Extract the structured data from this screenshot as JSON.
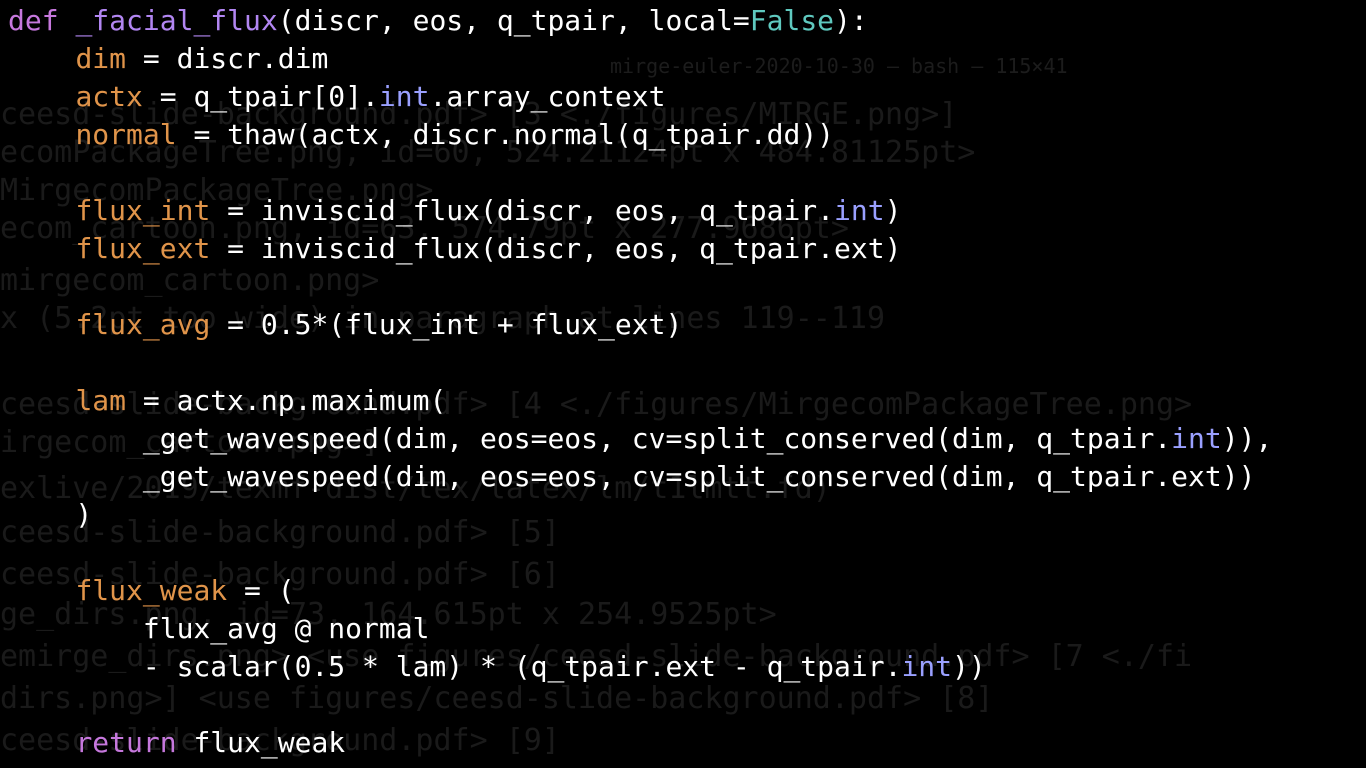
{
  "terminal": {
    "window_title": "mirge-euler-2020-10-30 — bash — 115×41",
    "background_output": [
      "ceesd-slide-background.pdf> [3 <./figures/MIRGE.png>]",
      "ecomPackageTree.png, id=60, 524.21124pt x 484.81125pt>",
      "MirgecomPackageTree.png>",
      "ecom_cartoon.png, id=63, 574.79pt x 277.9686pt>",
      "mirgecom_cartoon.png>",
      "x (5.2pt too wide) in paragraph at lines 119--119",
      "ceesd-slide-background.pdf> [4 <./figures/MirgecomPackageTree.png>",
      "irgecom_cartoon.png>]",
      "exlive/2019/texmf-dist/tex/latex/lm/t1lmtt.fd)",
      "ceesd-slide-background.pdf> [5]",
      "ceesd-slide-background.pdf> [6]",
      "ge_dirs.png, id=73, 164.615pt x 254.9525pt>",
      "emirge_dirs.png> <use figures/ceesd-slide-background.pdf> [7 <./fi",
      "dirs.png>] <use figures/ceesd-slide-background.pdf> [8]",
      "ceesd-slide-background.pdf> [9]"
    ]
  },
  "code_lines": [
    [
      {
        "t": "def",
        "c": "kw"
      },
      {
        "t": " ",
        "c": "plain"
      },
      {
        "t": "_facial_flux",
        "c": "fn"
      },
      {
        "t": "(discr, eos, q_tpair, local=",
        "c": "plain"
      },
      {
        "t": "False",
        "c": "cst"
      },
      {
        "t": "):",
        "c": "plain"
      }
    ],
    [
      {
        "t": "    ",
        "c": "plain"
      },
      {
        "t": "dim",
        "c": "var"
      },
      {
        "t": " = discr.dim",
        "c": "plain"
      }
    ],
    [
      {
        "t": "    ",
        "c": "plain"
      },
      {
        "t": "actx",
        "c": "var"
      },
      {
        "t": " = q_tpair[0].",
        "c": "plain"
      },
      {
        "t": "int",
        "c": "attr"
      },
      {
        "t": ".array_context",
        "c": "plain"
      }
    ],
    [
      {
        "t": "    ",
        "c": "plain"
      },
      {
        "t": "normal",
        "c": "var"
      },
      {
        "t": " = thaw(actx, discr.normal(q_tpair.dd))",
        "c": "plain"
      }
    ],
    [],
    [
      {
        "t": "    ",
        "c": "plain"
      },
      {
        "t": "flux_int",
        "c": "var"
      },
      {
        "t": " = inviscid_flux(discr, eos, q_tpair.",
        "c": "plain"
      },
      {
        "t": "int",
        "c": "attr"
      },
      {
        "t": ")",
        "c": "plain"
      }
    ],
    [
      {
        "t": "    ",
        "c": "plain"
      },
      {
        "t": "flux_ext",
        "c": "var"
      },
      {
        "t": " = inviscid_flux(discr, eos, q_tpair.ext)",
        "c": "plain"
      }
    ],
    [],
    [
      {
        "t": "    ",
        "c": "plain"
      },
      {
        "t": "flux_avg",
        "c": "var"
      },
      {
        "t": " = 0.5*(flux_int + flux_ext)",
        "c": "plain"
      }
    ],
    [],
    [
      {
        "t": "    ",
        "c": "plain"
      },
      {
        "t": "lam",
        "c": "var"
      },
      {
        "t": " = actx.np.maximum(",
        "c": "plain"
      }
    ],
    [
      {
        "t": "        _get_wavespeed(dim, eos=eos, cv=split_conserved(dim, q_tpair.",
        "c": "plain"
      },
      {
        "t": "int",
        "c": "attr"
      },
      {
        "t": ")),",
        "c": "plain"
      }
    ],
    [
      {
        "t": "        _get_wavespeed(dim, eos=eos, cv=split_conserved(dim, q_tpair.ext))",
        "c": "plain"
      }
    ],
    [
      {
        "t": "    )",
        "c": "plain"
      }
    ],
    [],
    [
      {
        "t": "    ",
        "c": "plain"
      },
      {
        "t": "flux_weak",
        "c": "var"
      },
      {
        "t": " = (",
        "c": "plain"
      }
    ],
    [
      {
        "t": "        flux_avg @ normal",
        "c": "plain"
      }
    ],
    [
      {
        "t": "        - scalar(0.5 * lam) * (q_tpair.ext - q_tpair.",
        "c": "plain"
      },
      {
        "t": "int",
        "c": "attr"
      },
      {
        "t": "))",
        "c": "plain"
      }
    ],
    [],
    [
      {
        "t": "    ",
        "c": "plain"
      },
      {
        "t": "return",
        "c": "kw"
      },
      {
        "t": " flux_weak",
        "c": "plain"
      }
    ]
  ]
}
